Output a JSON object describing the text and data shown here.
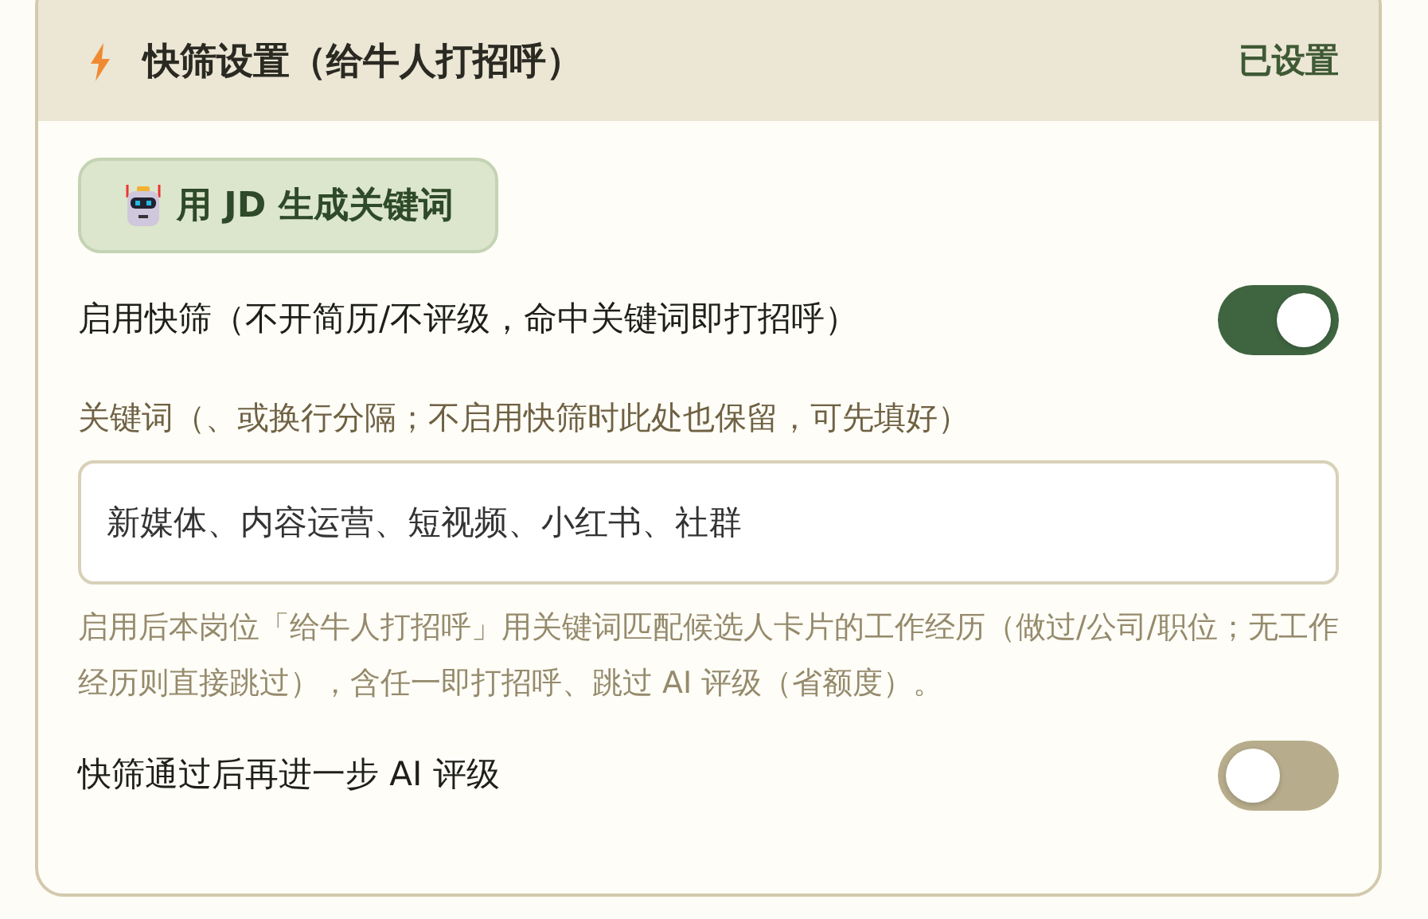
{
  "panel": {
    "title": "快筛设置（给牛人打招呼）",
    "status": "已设置"
  },
  "generate_button": {
    "label": "用 JD 生成关键词"
  },
  "settings": [
    {
      "kind": "toggle",
      "label": "启用快筛（不开简历/不评级，命中关键词即打招呼）",
      "on": true
    },
    {
      "kind": "field",
      "label": "关键词（、或换行分隔；不启用快筛时此处也保留，可先填好）",
      "value": "新媒体、内容运营、短视频、小红书、社群"
    },
    {
      "kind": "hint",
      "text": "启用后本岗位「给牛人打招呼」用关键词匹配候选人卡片的工作经历（做过/公司/职位；无工作经历则直接跳过），含任一即打招呼、跳过 AI 评级（省额度）。"
    },
    {
      "kind": "toggle",
      "label": "快筛通过后再进一步 AI 评级",
      "on": false
    }
  ]
}
